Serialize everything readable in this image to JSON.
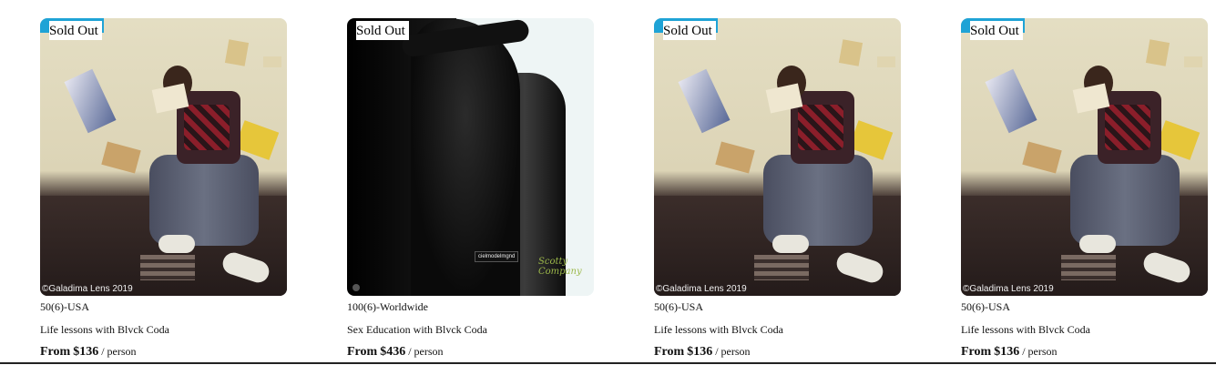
{
  "products": [
    {
      "badge": "Sold Out",
      "location": "50(6)-USA",
      "title": "Life lessons with Blvck Coda",
      "price_prefix": "From",
      "price": "$136",
      "price_unit": "/ person",
      "image": "reading-man",
      "watermark": "©Galadima Lens 2019"
    },
    {
      "badge": "Sold Out",
      "location": "100(6)-Worldwide",
      "title": "Sex Education with Blvck Coda",
      "price_prefix": "From",
      "price": "$436",
      "price_unit": "/ person",
      "image": "couple-monochrome",
      "tag": "cielmodelmgnd",
      "signature": "Scotty Company"
    },
    {
      "badge": "Sold Out",
      "location": "50(6)-USA",
      "title": "Life lessons with Blvck Coda",
      "price_prefix": "From",
      "price": "$136",
      "price_unit": "/ person",
      "image": "reading-man",
      "watermark": "©Galadima Lens 2019"
    },
    {
      "badge": "Sold Out",
      "location": "50(6)-USA",
      "title": "Life lessons with Blvck Coda",
      "price_prefix": "From",
      "price": "$136",
      "price_unit": "/ person",
      "image": "reading-man",
      "watermark": "©Galadima Lens 2019"
    }
  ]
}
